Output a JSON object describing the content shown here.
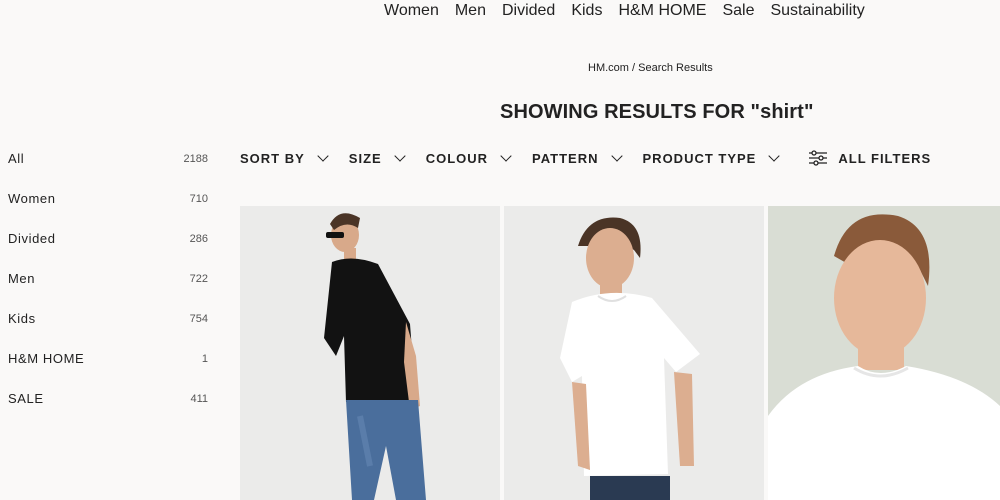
{
  "topnav": [
    "Women",
    "Men",
    "Divided",
    "Kids",
    "H&M HOME",
    "Sale",
    "Sustainability"
  ],
  "breadcrumb": {
    "home": "HM.com",
    "separator": " / ",
    "current": "Search Results"
  },
  "results_title": "SHOWING RESULTS FOR \"shirt\"",
  "sidebar": [
    {
      "label": "All",
      "count": "2188"
    },
    {
      "label": "Women",
      "count": "710"
    },
    {
      "label": "Divided",
      "count": "286"
    },
    {
      "label": "Men",
      "count": "722"
    },
    {
      "label": "Kids",
      "count": "754"
    },
    {
      "label": "H&M HOME",
      "count": "1"
    },
    {
      "label": "SALE",
      "count": "411"
    }
  ],
  "filters": {
    "sort_by": "SORT BY",
    "size": "SIZE",
    "colour": "COLOUR",
    "pattern": "PATTERN",
    "product_type": "PRODUCT TYPE",
    "all_filters": "ALL FILTERS"
  },
  "products": [
    {
      "image": "man-black-tshirt-jeans",
      "background": "#ebebea"
    },
    {
      "image": "man-white-tshirt",
      "background": "#ebebea"
    },
    {
      "image": "man-white-tshirt-closeup",
      "background": "#d9ddd4"
    }
  ]
}
